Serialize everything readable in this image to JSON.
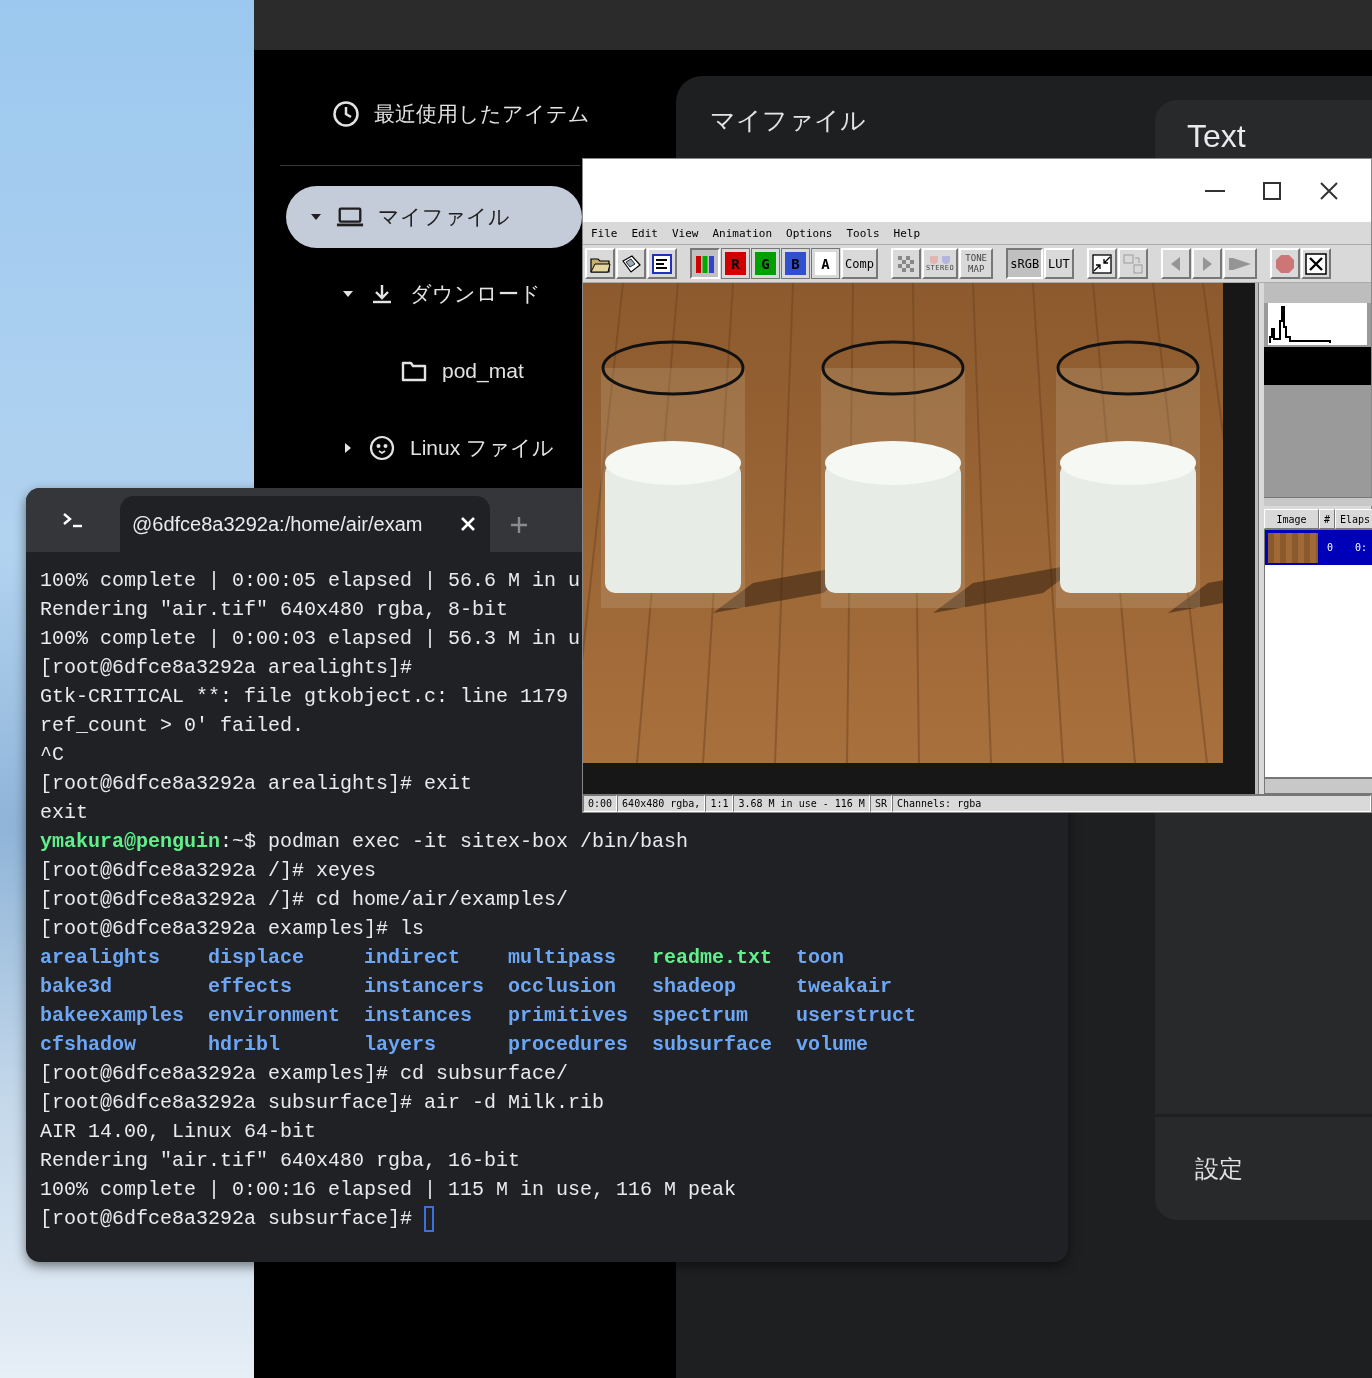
{
  "files_app": {
    "sidebar": {
      "recent": {
        "label": "最近使用したアイテム"
      },
      "tree": [
        {
          "label": "マイファイル",
          "kind": "computer",
          "selected": true,
          "expandable": true,
          "expanded": true,
          "children": [
            {
              "label": "ダウンロード",
              "kind": "downloads",
              "selected": false,
              "expandable": true,
              "expanded": true,
              "children": [
                {
                  "label": "pod_mat",
                  "kind": "folder",
                  "selected": false,
                  "expandable": false,
                  "expanded": false
                }
              ]
            },
            {
              "label": "Linux ファイル",
              "kind": "linux",
              "selected": false,
              "expandable": true,
              "expanded": false
            }
          ]
        }
      ]
    },
    "title": "マイファイル",
    "details_panel": {
      "title": "Text",
      "settings": "設定"
    }
  },
  "viewer": {
    "menu": [
      "File",
      "Edit",
      "View",
      "Animation",
      "Options",
      "Tools",
      "Help"
    ],
    "toolbar": [
      {
        "items": [
          {
            "kind": "folder",
            "selected": false,
            "disabled": false
          },
          {
            "kind": "floppy",
            "selected": false,
            "disabled": false
          },
          {
            "kind": "text-window",
            "selected": false,
            "disabled": false
          }
        ]
      },
      {
        "items": [
          {
            "kind": "channels",
            "selected": true,
            "disabled": false
          },
          {
            "kind": "letter",
            "label": "R",
            "color": "#d00000",
            "selected": false,
            "disabled": false
          },
          {
            "kind": "letter",
            "label": "G",
            "color": "#00a000",
            "selected": false,
            "disabled": false
          },
          {
            "kind": "letter",
            "label": "B",
            "color": "#3050d0",
            "selected": false,
            "disabled": false
          },
          {
            "kind": "letter",
            "label": "A",
            "color": "#ffffff",
            "selected": false,
            "disabled": false
          },
          {
            "kind": "text",
            "label": "Comp",
            "selected": false,
            "disabled": false
          }
        ]
      },
      {
        "items": [
          {
            "kind": "checker",
            "selected": false,
            "disabled": false
          },
          {
            "kind": "stereo",
            "label": "STEREO",
            "selected": false,
            "disabled": true
          },
          {
            "kind": "tonemap",
            "label": "TONE MAP",
            "selected": false,
            "disabled": true
          }
        ]
      },
      {
        "items": [
          {
            "kind": "text",
            "label": "sRGB",
            "selected": true,
            "disabled": false
          },
          {
            "kind": "text",
            "label": "LUT",
            "selected": false,
            "disabled": false
          }
        ]
      },
      {
        "items": [
          {
            "kind": "fit",
            "selected": false,
            "disabled": false
          },
          {
            "kind": "swap",
            "selected": false,
            "disabled": true
          }
        ]
      },
      {
        "items": [
          {
            "kind": "prev",
            "selected": false,
            "disabled": true
          },
          {
            "kind": "next",
            "selected": false,
            "disabled": true
          },
          {
            "kind": "play",
            "selected": false,
            "disabled": true
          }
        ]
      },
      {
        "items": [
          {
            "kind": "stop",
            "selected": false,
            "disabled": true
          },
          {
            "kind": "close",
            "selected": false,
            "disabled": false
          }
        ]
      }
    ],
    "image_list": {
      "columns": [
        "Image",
        "#",
        "Elaps"
      ],
      "rows": [
        {
          "number": "0",
          "elapsed": "0:",
          "selected": true
        }
      ]
    },
    "status_bar": [
      "0:00",
      "640x480 rgba,",
      "1:1",
      "3.68 M in use - 116 M",
      "SR",
      "Channels: rgba"
    ]
  },
  "terminal": {
    "tab_title": "@6dfce8a3292a:/home/air/exam",
    "cursor": true,
    "lines": [
      {
        "kind": "output",
        "text": "100% complete | 0:00:05 elapsed | 56.6 M in u"
      },
      {
        "kind": "output",
        "text": "Rendering \"air.tif\" 640x480 rgba, 8-bit"
      },
      {
        "kind": "output",
        "text": "100% complete | 0:00:03 elapsed | 56.3 M in u"
      },
      {
        "kind": "output",
        "text": "[root@6dfce8a3292a arealights]#"
      },
      {
        "kind": "output",
        "text": "Gtk-CRITICAL **: file gtkobject.c: line 1179"
      },
      {
        "kind": "output",
        "text": "ref_count > 0' failed."
      },
      {
        "kind": "output",
        "text": "^C"
      },
      {
        "kind": "output",
        "text": "[root@6dfce8a3292a arealights]# exit"
      },
      {
        "kind": "output",
        "text": "exit"
      },
      {
        "kind": "user_prompt",
        "user": "ymakura@penguin",
        "text": ":~$ podman exec -it sitex-box /bin/bash"
      },
      {
        "kind": "output",
        "text": "[root@6dfce8a3292a /]# xeyes"
      },
      {
        "kind": "output",
        "text": "[root@6dfce8a3292a /]# cd home/air/examples/"
      },
      {
        "kind": "output",
        "text": "[root@6dfce8a3292a examples]# ls"
      },
      {
        "kind": "listing",
        "columns": [
          [
            {
              "name": "arealights",
              "kind": "dir"
            },
            {
              "name": "bake3d",
              "kind": "dir"
            },
            {
              "name": "bakeexamples",
              "kind": "dir"
            },
            {
              "name": "cfshadow",
              "kind": "dir"
            }
          ],
          [
            {
              "name": "displace",
              "kind": "dir"
            },
            {
              "name": "effects",
              "kind": "dir"
            },
            {
              "name": "environment",
              "kind": "dir"
            },
            {
              "name": "hdribl",
              "kind": "dir"
            }
          ],
          [
            {
              "name": "indirect",
              "kind": "dir"
            },
            {
              "name": "instancers",
              "kind": "dir"
            },
            {
              "name": "instances",
              "kind": "dir"
            },
            {
              "name": "layers",
              "kind": "dir"
            }
          ],
          [
            {
              "name": "multipass",
              "kind": "dir"
            },
            {
              "name": "occlusion",
              "kind": "dir"
            },
            {
              "name": "primitives",
              "kind": "dir"
            },
            {
              "name": "procedures",
              "kind": "dir"
            }
          ],
          [
            {
              "name": "readme.txt",
              "kind": "file"
            },
            {
              "name": "shadeop",
              "kind": "dir"
            },
            {
              "name": "spectrum",
              "kind": "dir"
            },
            {
              "name": "subsurface",
              "kind": "dir"
            }
          ],
          [
            {
              "name": "toon",
              "kind": "dir"
            },
            {
              "name": "tweakair",
              "kind": "dir"
            },
            {
              "name": "userstruct",
              "kind": "dir"
            },
            {
              "name": "volume",
              "kind": "dir"
            }
          ]
        ]
      },
      {
        "kind": "output",
        "text": "[root@6dfce8a3292a examples]# cd subsurface/"
      },
      {
        "kind": "output",
        "text": "[root@6dfce8a3292a subsurface]# air -d Milk.rib"
      },
      {
        "kind": "output",
        "text": "AIR 14.00, Linux 64-bit"
      },
      {
        "kind": "output",
        "text": "Rendering \"air.tif\" 640x480 rgba, 16-bit"
      },
      {
        "kind": "output",
        "text": "100% complete | 0:00:16 elapsed | 115 M in use, 116 M peak"
      },
      {
        "kind": "output",
        "text": "[root@6dfce8a3292a subsurface]#"
      }
    ]
  }
}
